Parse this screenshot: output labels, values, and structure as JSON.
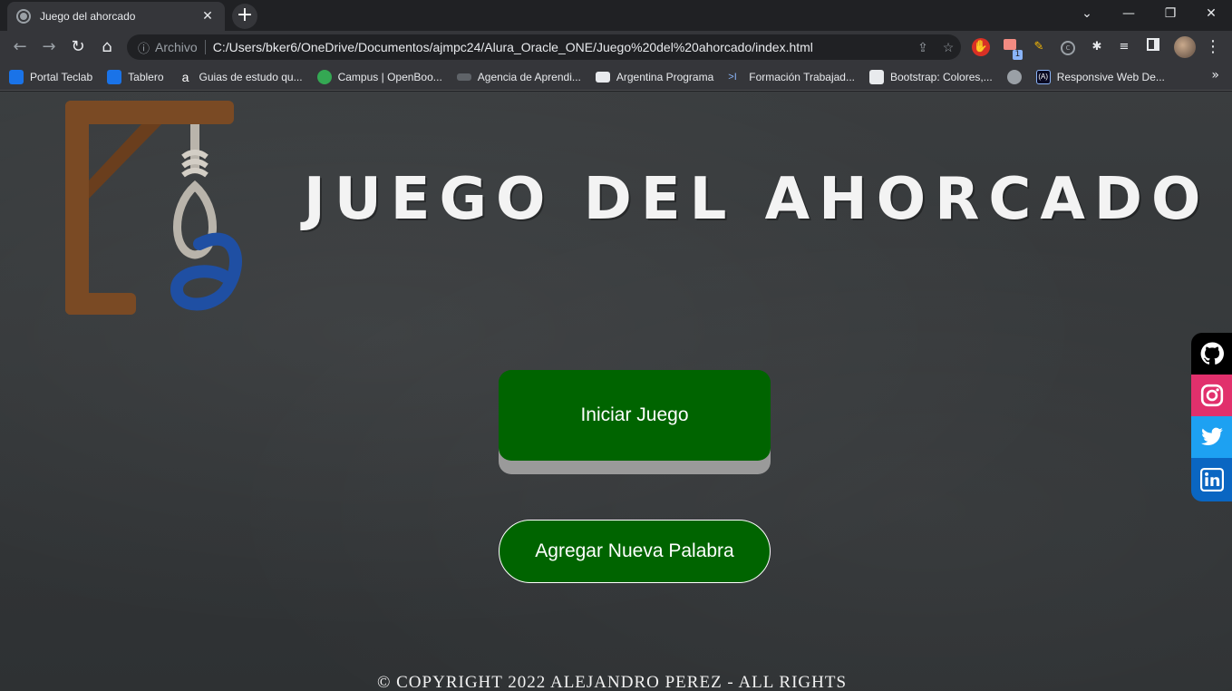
{
  "browser": {
    "tab_title": "Juego del ahorcado",
    "tab_close": "✕",
    "new_tab": "+",
    "window_controls": {
      "chevron": "⌄",
      "minimize": "—",
      "restore": "❐",
      "close": "✕"
    },
    "nav": {
      "back": "←",
      "forward": "→",
      "reload": "↻",
      "home": "⌂"
    },
    "omnibox": {
      "info_icon": "ⓘ",
      "scheme_label": "Archivo",
      "url": "C:/Users/bker6/OneDrive/Documentos/ajmpc24/Alura_Oracle_ONE/Juego%20del%20ahorcado/index.html",
      "share_icon": "⇪",
      "star_icon": "☆"
    },
    "extensions": [
      "stop-hand-icon",
      "extension-badge-icon",
      "pen-icon",
      "circle-c-icon",
      "puzzle-icon",
      "media-icon",
      "sidebar-icon",
      "profile-avatar",
      "kebab-menu-icon"
    ],
    "extension_badge": "1",
    "menu": "⋮",
    "bookmarks": [
      {
        "label": "Portal Teclab",
        "color": "#1a73e8"
      },
      {
        "label": "Tablero",
        "color": "#1a73e8"
      },
      {
        "label": "Guias de estudo qu...",
        "color": "#ffffff"
      },
      {
        "label": "Campus | OpenBoo...",
        "color": "#34a853"
      },
      {
        "label": "Agencia de Aprendi...",
        "color": "#5f6368"
      },
      {
        "label": "Argentina Programa",
        "color": "#8ab4f8"
      },
      {
        "label": "Formación Trabajad...",
        "color": "#8ab4f8"
      },
      {
        "label": "Bootstrap: Colores,...",
        "color": "#e8eaed"
      },
      {
        "label": "",
        "color": "#9aa0a6"
      },
      {
        "label": "Responsive Web De...",
        "color": "#0a0a23"
      }
    ],
    "bookmarks_more": "»"
  },
  "page": {
    "title": "JUEGO DEL AHORCADO",
    "start_button": "Iniciar Juego",
    "add_word_button": "Agregar Nueva Palabra",
    "copyright": "© COPYRIGHT 2022 ALEJANDRO PEREZ - ALL RIGHTS",
    "social": [
      "github-icon",
      "instagram-icon",
      "twitter-icon",
      "linkedin-icon"
    ],
    "colors": {
      "button_green": "#006400",
      "button_shadow": "#9a9a9a",
      "gallows_brown": "#7a4a24",
      "rope": "#b9b4ab",
      "alura_blue": "#1f4fa3",
      "github": "#000000",
      "instagram": "#e1306c",
      "twitter": "#1da1f2",
      "linkedin": "#0a66c2"
    }
  }
}
